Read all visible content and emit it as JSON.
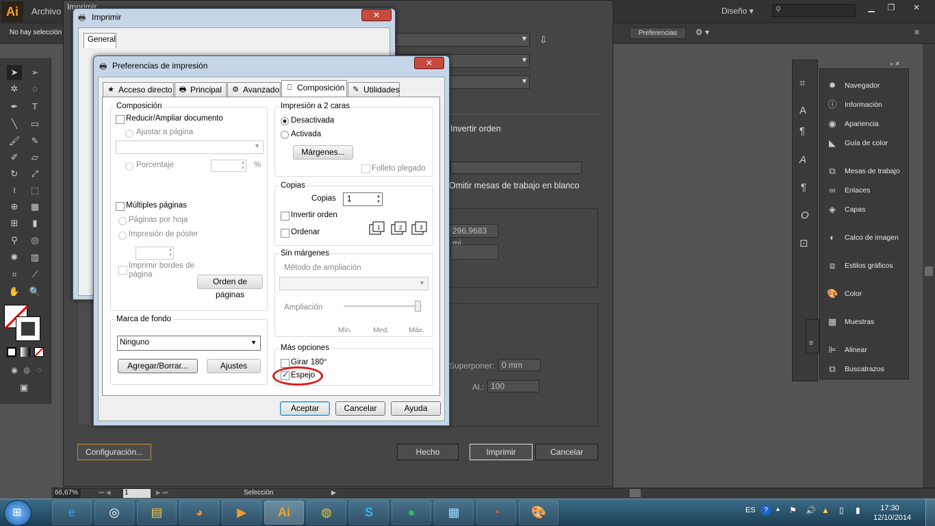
{
  "illustrator": {
    "logo": "Ai",
    "menu_file": "Archivo",
    "dialog_peek": "Imprimir",
    "workspace": "Diseño",
    "no_selection": "No hay selección",
    "preferences_button": "Preferencias",
    "zoom": "66,67%",
    "page": "1",
    "status": "Selección"
  },
  "panels": [
    {
      "name": "Navegador",
      "icon": "navigator-icon"
    },
    {
      "name": "Información",
      "icon": "info-icon"
    },
    {
      "name": "Apariencia",
      "icon": "appearance-icon"
    },
    {
      "name": "Guía de color",
      "icon": "color-guide-icon"
    },
    {
      "name": "Mesas de trabajo",
      "icon": "artboards-icon"
    },
    {
      "name": "Enlaces",
      "icon": "links-icon"
    },
    {
      "name": "Capas",
      "icon": "layers-icon"
    },
    {
      "name": "Calco de imagen",
      "icon": "image-trace-icon"
    },
    {
      "name": "Estilos gráficos",
      "icon": "graphic-styles-icon"
    },
    {
      "name": "Color",
      "icon": "color-icon"
    },
    {
      "name": "Muestras",
      "icon": "swatches-icon"
    },
    {
      "name": "Alinear",
      "icon": "align-icon"
    },
    {
      "name": "Buscatrazos",
      "icon": "pathfinder-icon"
    }
  ],
  "print_dialog": {
    "invert_order": "Invertir orden",
    "omit_artboards": "Omitir mesas de trabajo en blanco",
    "size_value": "296,9683 mi",
    "overlap_label": "Superponer:",
    "overlap_value": "0 mm",
    "height_label": "Al.:",
    "height_value": "100",
    "setup_button": "Configuración...",
    "done_button": "Hecho",
    "print_button": "Imprimir",
    "cancel_button": "Cancelar"
  },
  "win_print": {
    "title": "Imprimir",
    "tab": "General"
  },
  "prefs": {
    "title": "Preferencias de impresión",
    "tabs": [
      "Acceso directo",
      "Principal",
      "Avanzado",
      "Composición",
      "Utilidades"
    ],
    "active_tab": "Composición",
    "composition": {
      "group": "Composición",
      "reduce": "Reducir/Ampliar documento",
      "fit_page": "Ajustar a página",
      "percentage": "Porcentaje",
      "percent_sign": "%",
      "multiple_pages": "Múltiples páginas",
      "pages_per_sheet": "Páginas por hoja",
      "poster": "Impresión de póster",
      "print_borders": "Imprimir bordes de página",
      "page_order": "Orden de páginas"
    },
    "duplex": {
      "group": "Impresión a 2 caras",
      "off": "Desactivada",
      "on": "Activada",
      "margins": "Márgenes...",
      "booklet": "Folleto plegado"
    },
    "copies": {
      "group": "Copias",
      "label": "Copias",
      "value": "1",
      "reverse": "Invertir orden",
      "collate": "Ordenar"
    },
    "borderless": {
      "group": "Sin márgenes",
      "method": "Método de ampliación",
      "amount": "Ampliación",
      "min": "Mín.",
      "med": "Med.",
      "max": "Máx."
    },
    "watermark": {
      "group": "Marca de fondo",
      "value": "Ninguno",
      "add_remove": "Agregar/Borrar...",
      "settings": "Ajustes"
    },
    "more": {
      "group": "Más opciones",
      "rotate": "Girar 180°",
      "mirror": "Espejo",
      "mirror_checked": true
    },
    "buttons": {
      "ok": "Aceptar",
      "cancel": "Cancelar",
      "help": "Ayuda"
    }
  },
  "taskbar": {
    "lang": "ES",
    "time": "17:30",
    "date": "12/10/2014",
    "apps": [
      "start-orb",
      "internet-explorer-icon",
      "chrome-icon",
      "file-explorer-icon",
      "firefox-icon",
      "media-player-icon",
      "illustrator-icon",
      "chrome-pinned-icon",
      "skype-icon",
      "spotify-icon",
      "control-panel-icon",
      "app-icon",
      "paint-icon"
    ]
  }
}
